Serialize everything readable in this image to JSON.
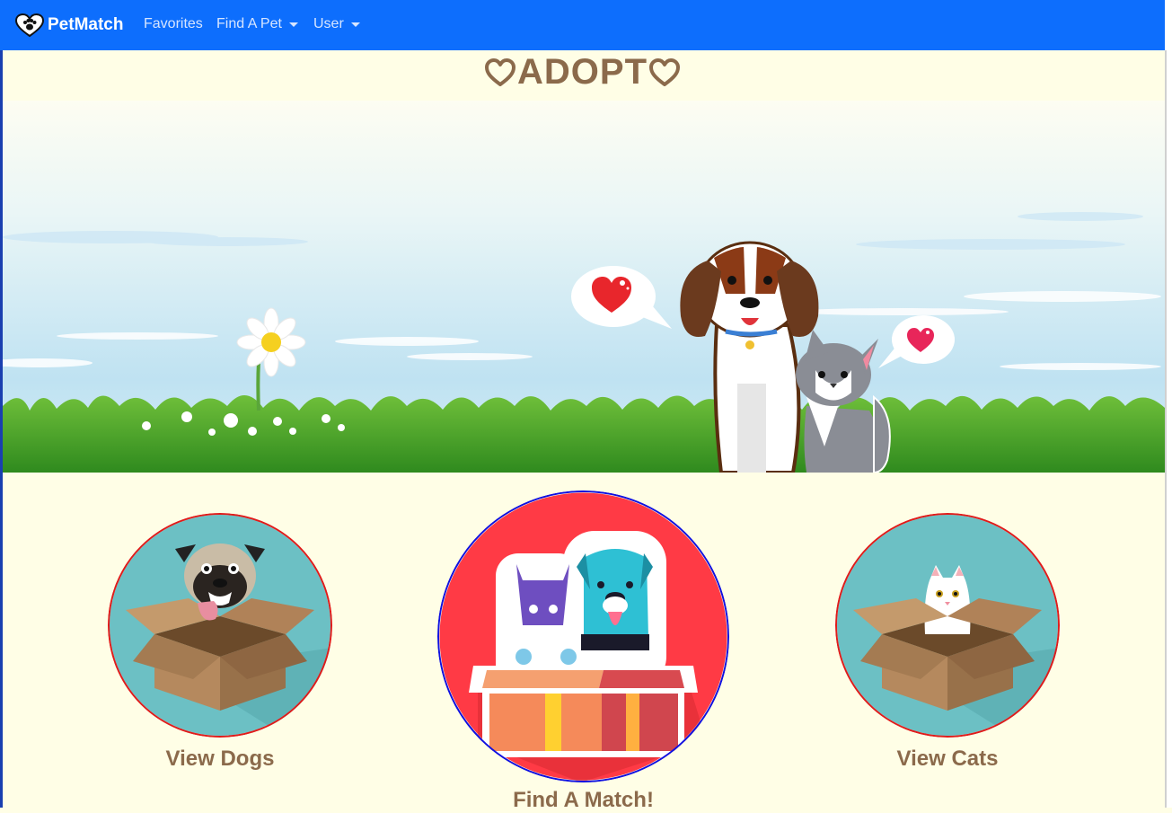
{
  "nav": {
    "brand": "PetMatch",
    "favorites": "Favorites",
    "find_a_pet": "Find A Pet",
    "user": "User"
  },
  "hero": {
    "title": "ADOPT"
  },
  "cards": {
    "dogs_label": "View Dogs",
    "match_label": "Find A Match!",
    "cats_label": "View Cats"
  },
  "icons": {
    "brand": "paw-heart-icon",
    "title": "heart-outline-icon"
  },
  "colors": {
    "navbar": "#0d6efd",
    "background": "#fffee6",
    "accent_text": "#8b6a4b",
    "dogs_ring": "#e01b1b",
    "match_ring": "#1010e0",
    "cats_ring": "#e01b1b"
  }
}
